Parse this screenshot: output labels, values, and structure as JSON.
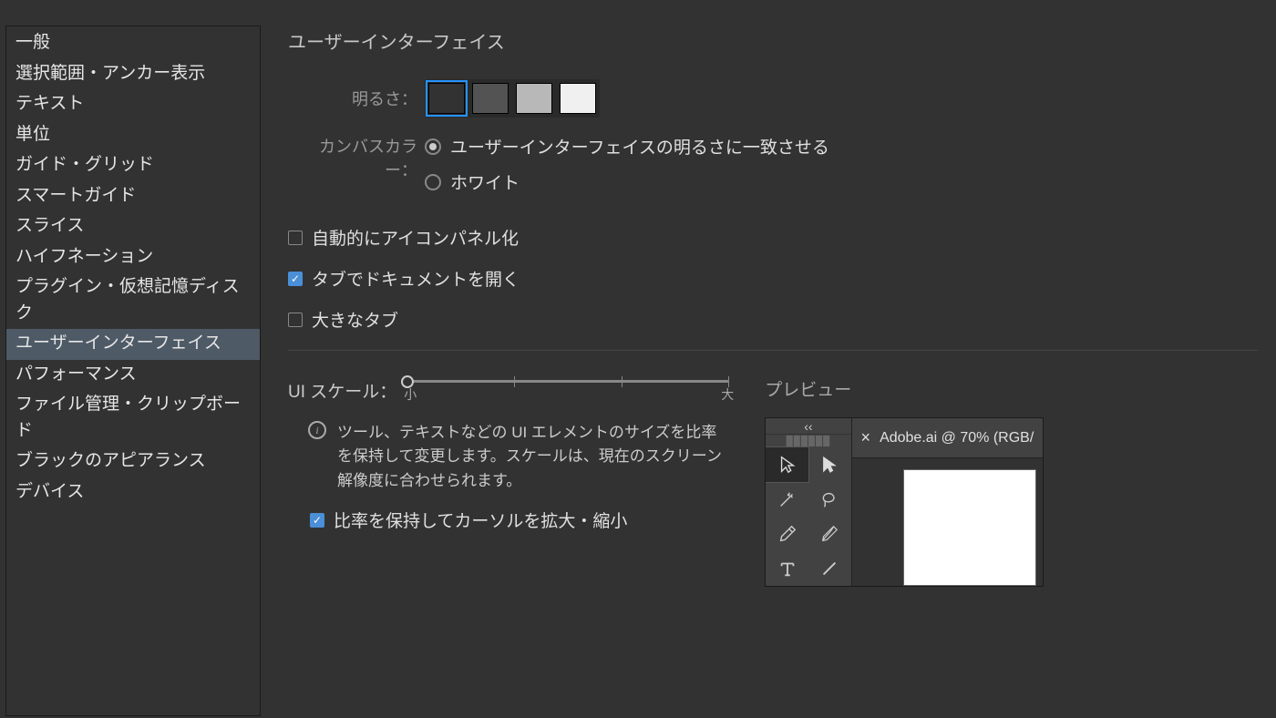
{
  "sidebar": {
    "items": [
      {
        "label": "一般"
      },
      {
        "label": "選択範囲・アンカー表示"
      },
      {
        "label": "テキスト"
      },
      {
        "label": "単位"
      },
      {
        "label": "ガイド・グリッド"
      },
      {
        "label": "スマートガイド"
      },
      {
        "label": "スライス"
      },
      {
        "label": "ハイフネーション"
      },
      {
        "label": "プラグイン・仮想記憶ディスク"
      },
      {
        "label": "ユーザーインターフェイス"
      },
      {
        "label": "パフォーマンス"
      },
      {
        "label": "ファイル管理・クリップボード"
      },
      {
        "label": "ブラックのアピアランス"
      },
      {
        "label": "デバイス"
      }
    ],
    "selected_index": 9
  },
  "main": {
    "title": "ユーザーインターフェイス",
    "brightness_label": "明るさ：",
    "brightness_swatches": [
      "#323232",
      "#535353",
      "#b8b8b8",
      "#f0f0f0"
    ],
    "brightness_selected": 0,
    "canvas_label": "カンバスカラー：",
    "canvas_options": [
      {
        "label": "ユーザーインターフェイスの明るさに一致させる",
        "checked": true
      },
      {
        "label": "ホワイト",
        "checked": false
      }
    ],
    "checks": {
      "auto_collapse": {
        "label": "自動的にアイコンパネル化",
        "checked": false
      },
      "tab_open": {
        "label": "タブでドキュメントを開く",
        "checked": true
      },
      "large_tabs": {
        "label": "大きなタブ",
        "checked": false
      }
    },
    "scale": {
      "label": "UI スケール：",
      "min_label": "小",
      "max_label": "大",
      "value": 0,
      "info": "ツール、テキストなどの UI エレメントのサイズを比率を保持して変更します。スケールは、現在のスクリーン解像度に合わせられます。",
      "preserve_cursor": {
        "label": "比率を保持してカーソルを拡大・縮小",
        "checked": true
      }
    },
    "preview": {
      "title": "プレビュー",
      "tab_close": "×",
      "tab_label": "Adobe.ai @ 70% (RGB/",
      "collapse": "‹‹"
    }
  }
}
